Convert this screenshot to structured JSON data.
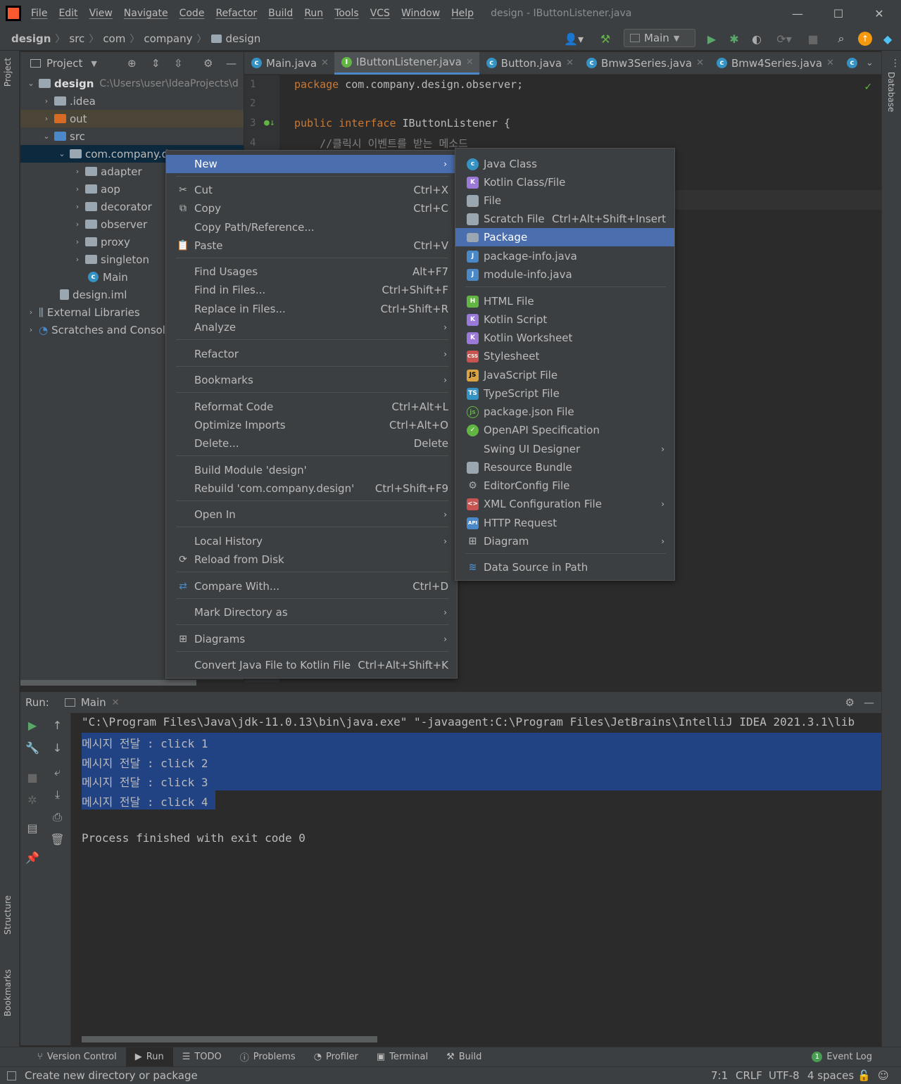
{
  "window": {
    "title": "design - IButtonListener.java"
  },
  "menu": [
    "File",
    "Edit",
    "View",
    "Navigate",
    "Code",
    "Refactor",
    "Build",
    "Run",
    "Tools",
    "VCS",
    "Window",
    "Help"
  ],
  "breadcrumb": [
    "design",
    "src",
    "com",
    "company",
    "design"
  ],
  "run_config": "Main",
  "project_panel": {
    "title": "Project"
  },
  "tree": [
    {
      "label": "design",
      "path": "C:\\Users\\user\\IdeaProjects\\d"
    },
    {
      "label": ".idea"
    },
    {
      "label": "out"
    },
    {
      "label": "src"
    },
    {
      "label": "com.company.de"
    },
    {
      "label": "adapter"
    },
    {
      "label": "aop"
    },
    {
      "label": "decorator"
    },
    {
      "label": "observer"
    },
    {
      "label": "proxy"
    },
    {
      "label": "singleton"
    },
    {
      "label": "Main"
    },
    {
      "label": "design.iml"
    },
    {
      "label": "External Libraries"
    },
    {
      "label": "Scratches and Console"
    }
  ],
  "tabs": [
    "Main.java",
    "IButtonListener.java",
    "Button.java",
    "Bmw3Series.java",
    "Bmw4Series.java"
  ],
  "editor": {
    "lines": [
      "1",
      "2",
      "3",
      "4"
    ],
    "line1_kw": "package",
    "line1_rest": " com.company.design.observer;",
    "line3_kw": "public interface",
    "line3_rest": " IButtonListener {",
    "line4": "    //클릭시 이벤트를 받는 메소드"
  },
  "context_menu": [
    {
      "label": "New",
      "shortcut": "",
      "submenu": true
    },
    {
      "label": "Cut",
      "shortcut": "Ctrl+X"
    },
    {
      "label": "Copy",
      "shortcut": "Ctrl+C"
    },
    {
      "label": "Copy Path/Reference...",
      "shortcut": ""
    },
    {
      "label": "Paste",
      "shortcut": "Ctrl+V"
    },
    {
      "label": "Find Usages",
      "shortcut": "Alt+F7"
    },
    {
      "label": "Find in Files...",
      "shortcut": "Ctrl+Shift+F"
    },
    {
      "label": "Replace in Files...",
      "shortcut": "Ctrl+Shift+R"
    },
    {
      "label": "Analyze",
      "shortcut": "",
      "submenu": true
    },
    {
      "label": "Refactor",
      "shortcut": "",
      "submenu": true
    },
    {
      "label": "Bookmarks",
      "shortcut": "",
      "submenu": true
    },
    {
      "label": "Reformat Code",
      "shortcut": "Ctrl+Alt+L"
    },
    {
      "label": "Optimize Imports",
      "shortcut": "Ctrl+Alt+O"
    },
    {
      "label": "Delete...",
      "shortcut": "Delete"
    },
    {
      "label": "Build Module 'design'",
      "shortcut": ""
    },
    {
      "label": "Rebuild 'com.company.design'",
      "shortcut": "Ctrl+Shift+F9"
    },
    {
      "label": "Open In",
      "shortcut": "",
      "submenu": true
    },
    {
      "label": "Local History",
      "shortcut": "",
      "submenu": true
    },
    {
      "label": "Reload from Disk",
      "shortcut": ""
    },
    {
      "label": "Compare With...",
      "shortcut": "Ctrl+D"
    },
    {
      "label": "Mark Directory as",
      "shortcut": "",
      "submenu": true
    },
    {
      "label": "Diagrams",
      "shortcut": "",
      "submenu": true
    },
    {
      "label": "Convert Java File to Kotlin File",
      "shortcut": "Ctrl+Alt+Shift+K"
    }
  ],
  "new_submenu": [
    {
      "label": "Java Class",
      "shortcut": ""
    },
    {
      "label": "Kotlin Class/File",
      "shortcut": ""
    },
    {
      "label": "File",
      "shortcut": ""
    },
    {
      "label": "Scratch File",
      "shortcut": "Ctrl+Alt+Shift+Insert"
    },
    {
      "label": "Package",
      "shortcut": ""
    },
    {
      "label": "package-info.java",
      "shortcut": ""
    },
    {
      "label": "module-info.java",
      "shortcut": ""
    },
    {
      "label": "HTML File",
      "shortcut": ""
    },
    {
      "label": "Kotlin Script",
      "shortcut": ""
    },
    {
      "label": "Kotlin Worksheet",
      "shortcut": ""
    },
    {
      "label": "Stylesheet",
      "shortcut": ""
    },
    {
      "label": "JavaScript File",
      "shortcut": ""
    },
    {
      "label": "TypeScript File",
      "shortcut": ""
    },
    {
      "label": "package.json File",
      "shortcut": ""
    },
    {
      "label": "OpenAPI Specification",
      "shortcut": ""
    },
    {
      "label": "Swing UI Designer",
      "shortcut": "",
      "submenu": true
    },
    {
      "label": "Resource Bundle",
      "shortcut": ""
    },
    {
      "label": "EditorConfig File",
      "shortcut": ""
    },
    {
      "label": "XML Configuration File",
      "shortcut": "",
      "submenu": true
    },
    {
      "label": "HTTP Request",
      "shortcut": ""
    },
    {
      "label": "Diagram",
      "shortcut": "",
      "submenu": true
    },
    {
      "label": "Data Source in Path",
      "shortcut": ""
    }
  ],
  "run_panel": {
    "label": "Run:",
    "tab": "Main",
    "console": [
      "\"C:\\Program Files\\Java\\jdk-11.0.13\\bin\\java.exe\" \"-javaagent:C:\\Program Files\\JetBrains\\IntelliJ IDEA 2021.3.1\\lib",
      "메시지 전달 : click 1",
      "메시지 전달 : click 2",
      "메시지 전달 : click 3",
      "메시지 전달 : click 4",
      "Process finished with exit code 0"
    ]
  },
  "bottom_tabs": [
    "Version Control",
    "Run",
    "TODO",
    "Problems",
    "Profiler",
    "Terminal",
    "Build"
  ],
  "event_log": {
    "count": "1",
    "label": "Event Log"
  },
  "status": {
    "message": "Create new directory or package",
    "position": "7:1",
    "line_sep": "CRLF",
    "encoding": "UTF-8",
    "indent": "4 spaces"
  },
  "side_tabs": {
    "left_top": "Project",
    "left_structure": "Structure",
    "left_bookmarks": "Bookmarks",
    "right": "Database"
  }
}
